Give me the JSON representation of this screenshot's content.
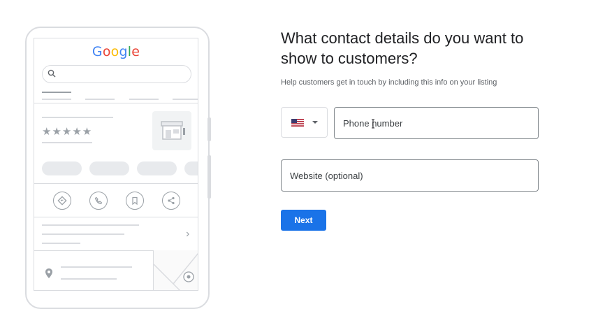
{
  "illustration": {
    "logo": "Google",
    "logo_colors": [
      "#4285F4",
      "#EA4335",
      "#FBBC05",
      "#4285F4",
      "#34A853",
      "#EA4335"
    ],
    "rating_stars": "★★★★★",
    "action_icons": [
      "directions-icon",
      "call-icon",
      "bookmark-icon",
      "share-icon"
    ]
  },
  "form": {
    "title": "What contact details do you want to show to customers?",
    "subtitle": "Help customers get in touch by including this info on your listing",
    "country_selector": {
      "flag": "us-flag-icon",
      "selected": "US"
    },
    "phone_placeholder": "Phone number",
    "website_placeholder": "Website (optional)",
    "next_label": "Next"
  },
  "colors": {
    "primary": "#1a73e8",
    "border": "#dadce0",
    "text": "#202124",
    "muted": "#5f6368"
  }
}
